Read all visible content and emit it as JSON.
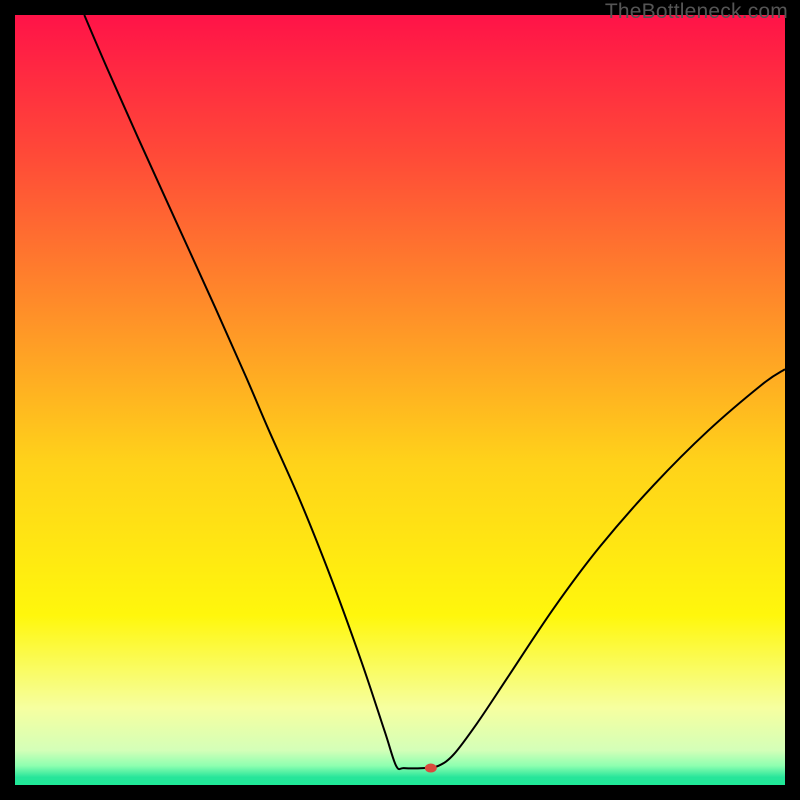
{
  "watermark": "TheBottleneck.com",
  "chart_data": {
    "type": "line",
    "title": "",
    "xlabel": "",
    "ylabel": "",
    "xlim": [
      0,
      100
    ],
    "ylim": [
      0,
      100
    ],
    "grid": false,
    "legend": false,
    "background": {
      "description": "vertical gradient red→orange→yellow→pale-green with thin green band at bottom",
      "stops": [
        {
          "pos": 0.0,
          "color": "#ff1348"
        },
        {
          "pos": 0.18,
          "color": "#ff4938"
        },
        {
          "pos": 0.38,
          "color": "#ff8d29"
        },
        {
          "pos": 0.58,
          "color": "#ffd21a"
        },
        {
          "pos": 0.78,
          "color": "#fff70c"
        },
        {
          "pos": 0.9,
          "color": "#f6ffa0"
        },
        {
          "pos": 0.955,
          "color": "#d4ffb8"
        },
        {
          "pos": 0.975,
          "color": "#8effb0"
        },
        {
          "pos": 0.99,
          "color": "#27e59a"
        },
        {
          "pos": 1.0,
          "color": "#1fe897"
        }
      ]
    },
    "series": [
      {
        "name": "bottleneck-curve",
        "color": "#000000",
        "width": 2,
        "points": [
          {
            "x": 9.0,
            "y": 100.0
          },
          {
            "x": 12.0,
            "y": 93.0
          },
          {
            "x": 16.0,
            "y": 84.0
          },
          {
            "x": 21.0,
            "y": 73.0
          },
          {
            "x": 26.0,
            "y": 62.0
          },
          {
            "x": 30.0,
            "y": 53.0
          },
          {
            "x": 33.0,
            "y": 46.0
          },
          {
            "x": 37.0,
            "y": 37.0
          },
          {
            "x": 41.0,
            "y": 27.0
          },
          {
            "x": 45.0,
            "y": 16.0
          },
          {
            "x": 48.0,
            "y": 7.0
          },
          {
            "x": 49.5,
            "y": 2.5
          },
          {
            "x": 50.5,
            "y": 2.2
          },
          {
            "x": 53.0,
            "y": 2.2
          },
          {
            "x": 55.0,
            "y": 2.5
          },
          {
            "x": 57.0,
            "y": 4.0
          },
          {
            "x": 60.0,
            "y": 8.0
          },
          {
            "x": 64.0,
            "y": 14.0
          },
          {
            "x": 70.0,
            "y": 23.0
          },
          {
            "x": 76.0,
            "y": 31.0
          },
          {
            "x": 83.0,
            "y": 39.0
          },
          {
            "x": 90.0,
            "y": 46.0
          },
          {
            "x": 97.0,
            "y": 52.0
          },
          {
            "x": 100.0,
            "y": 54.0
          }
        ]
      }
    ],
    "marker": {
      "name": "optimum-point",
      "x": 54.0,
      "y": 2.2,
      "color": "#d94a3e",
      "rx": 6,
      "ry": 4.5
    }
  }
}
